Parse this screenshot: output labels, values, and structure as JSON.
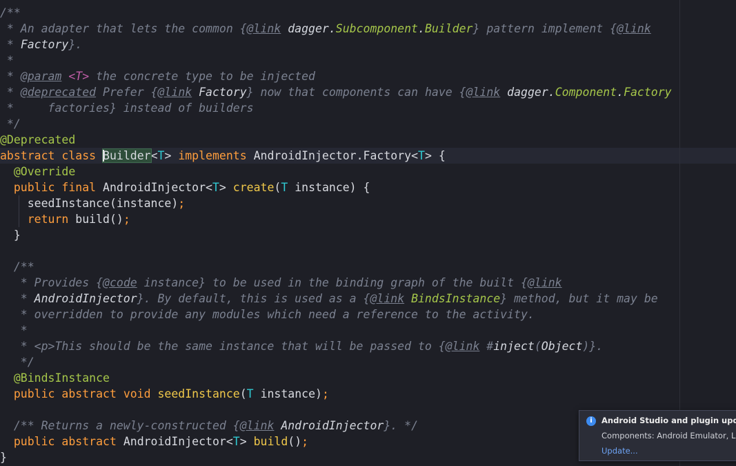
{
  "editor": {
    "l1": "/**",
    "l2": {
      "a": " * An adapter that lets the common ",
      "b": "{",
      "c": "@link",
      "d": " ",
      "e": "dagger.",
      "f": "Subcomponent",
      "g": ".",
      "h": "Builder",
      "i": "}",
      "j": " pattern implement ",
      "k": "{",
      "l": "@link"
    },
    "l3": {
      "a": " * ",
      "b": "Factory",
      "c": "}."
    },
    "l4": " *",
    "l5": {
      "a": " * ",
      "b": "@param",
      "c": " ",
      "d": "<T>",
      "e": " the concrete type to be injected"
    },
    "l6": {
      "a": " * ",
      "b": "@deprecated",
      "c": " Prefer ",
      "d": "{",
      "e": "@link",
      "f": " ",
      "g": "Factory",
      "h": "}",
      "i": " now that components can have ",
      "j": "{",
      "k": "@link",
      "l": " ",
      "m": "dagger.",
      "n": "Component",
      "o": ".",
      "p": "Factory"
    },
    "l7": " *     factories} instead of builders",
    "l8": " */",
    "l9": "@Deprecated",
    "l10": {
      "a": "abstract class ",
      "caret_char": "B",
      "b": "uilder",
      "c": "<",
      "d": "T",
      "e": "> ",
      "f": "implements",
      "g": " AndroidInjector.Factory<",
      "h": "T",
      "i": "> {"
    },
    "l11": "  @Override",
    "l12": {
      "a": "  ",
      "b": "public final",
      "c": " AndroidInjector<",
      "d": "T",
      "e": "> ",
      "f": "create",
      "g": "(",
      "h": "T",
      "i": " instance) {"
    },
    "l13": {
      "a": "    seedInstance(instance)",
      "b": ";"
    },
    "l14": {
      "a": "    ",
      "b": "return",
      "c": " build()",
      "d": ";"
    },
    "l15": "  }",
    "l17": "  /**",
    "l18": {
      "a": "   * Provides ",
      "b": "{",
      "c": "@code",
      "d": " instance} to be used in the binding graph of the built ",
      "e": "{",
      "f": "@link"
    },
    "l19": {
      "a": "   * ",
      "b": "AndroidInjector",
      "c": "}. By default, this is used as a ",
      "d": "{",
      "e": "@link",
      "f": " ",
      "g": "BindsInstance",
      "h": "}",
      "i": " method, but it may be"
    },
    "l20": "   * overridden to provide any modules which need a reference to the activity.",
    "l21": "   *",
    "l22": {
      "a": "   * <p>This should be the same instance that will be passed to ",
      "b": "{",
      "c": "@link",
      "d": " #",
      "e": "inject",
      "f": "(",
      "g": "Object",
      "h": ")}."
    },
    "l23": "   */",
    "l24": "  @BindsInstance",
    "l25": {
      "a": "  ",
      "b": "public abstract void",
      "c": " ",
      "d": "seedInstance",
      "e": "(",
      "f": "T",
      "g": " instance)",
      "h": ";"
    },
    "l27": {
      "a": "  /** Returns a newly-constructed ",
      "b": "{",
      "c": "@link",
      "d": " ",
      "e": "AndroidInjector",
      "f": "}. */"
    },
    "l28": {
      "a": "  ",
      "b": "public abstract",
      "c": " AndroidInjector<",
      "d": "T",
      "e": "> ",
      "f": "build",
      "g": "()",
      "h": ";"
    },
    "l29": "}"
  },
  "notification": {
    "icon": "info-icon",
    "title": "Android Studio and plugin updates available",
    "body": "Components: Android Emulator, Layout Inspector",
    "link": "Update..."
  }
}
